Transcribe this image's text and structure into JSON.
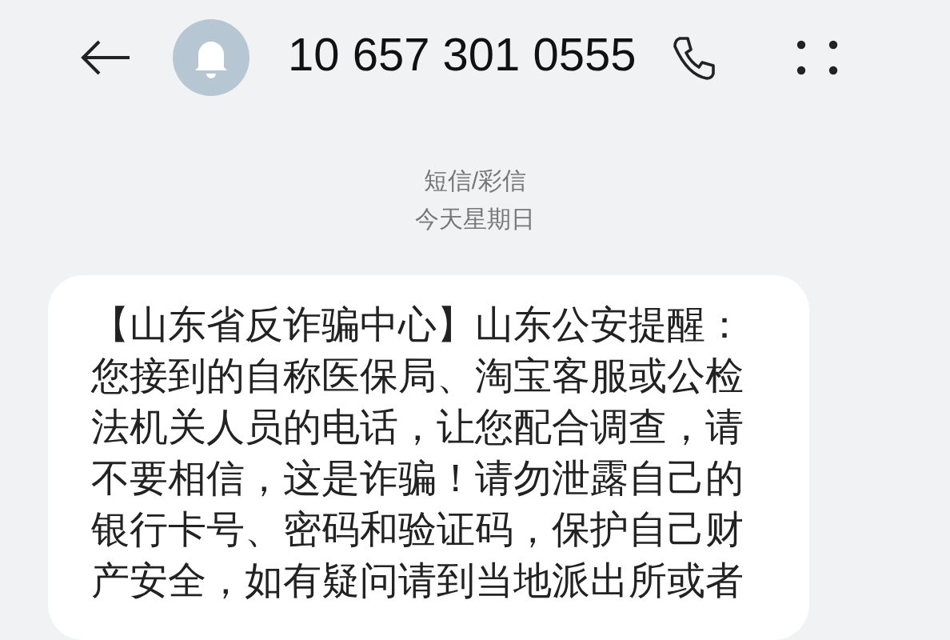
{
  "header": {
    "contact": "10 657 301 0555"
  },
  "thread_info": {
    "channel": "短信/彩信",
    "date": "今天星期日"
  },
  "messages": [
    {
      "text": "【山东省反诈骗中心】山东公安提醒：您接到的自称医保局、淘宝客服或公检法机关人员的电话，让您配合调查，请不要相信，这是诈骗！请勿泄露自己的银行卡号、密码和验证码，保护自己财产安全，如有疑问请到当地派出所或者"
    }
  ]
}
